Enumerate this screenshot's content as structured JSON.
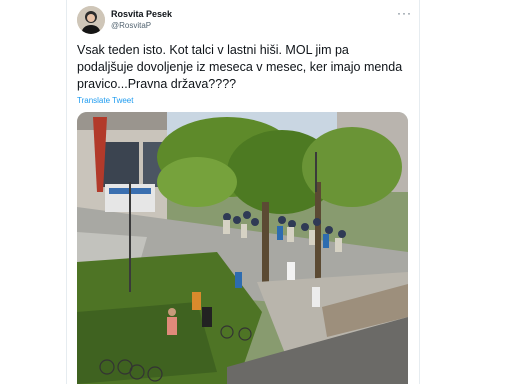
{
  "tweet": {
    "display_name": "Rosvita Pesek",
    "handle": "@RosvitaP",
    "more_icon": "more-horizontal-icon",
    "text": "Vsak teden isto. Kot talci v lastni hiši. MOL jim pa podaljšuje dovoljenje iz meseca v mesec, ker imajo menda pravico...Pravna država????",
    "translate_label": "Translate Tweet"
  },
  "colors": {
    "link": "#1d9bf0",
    "text": "#0f1419",
    "secondary": "#536471"
  }
}
